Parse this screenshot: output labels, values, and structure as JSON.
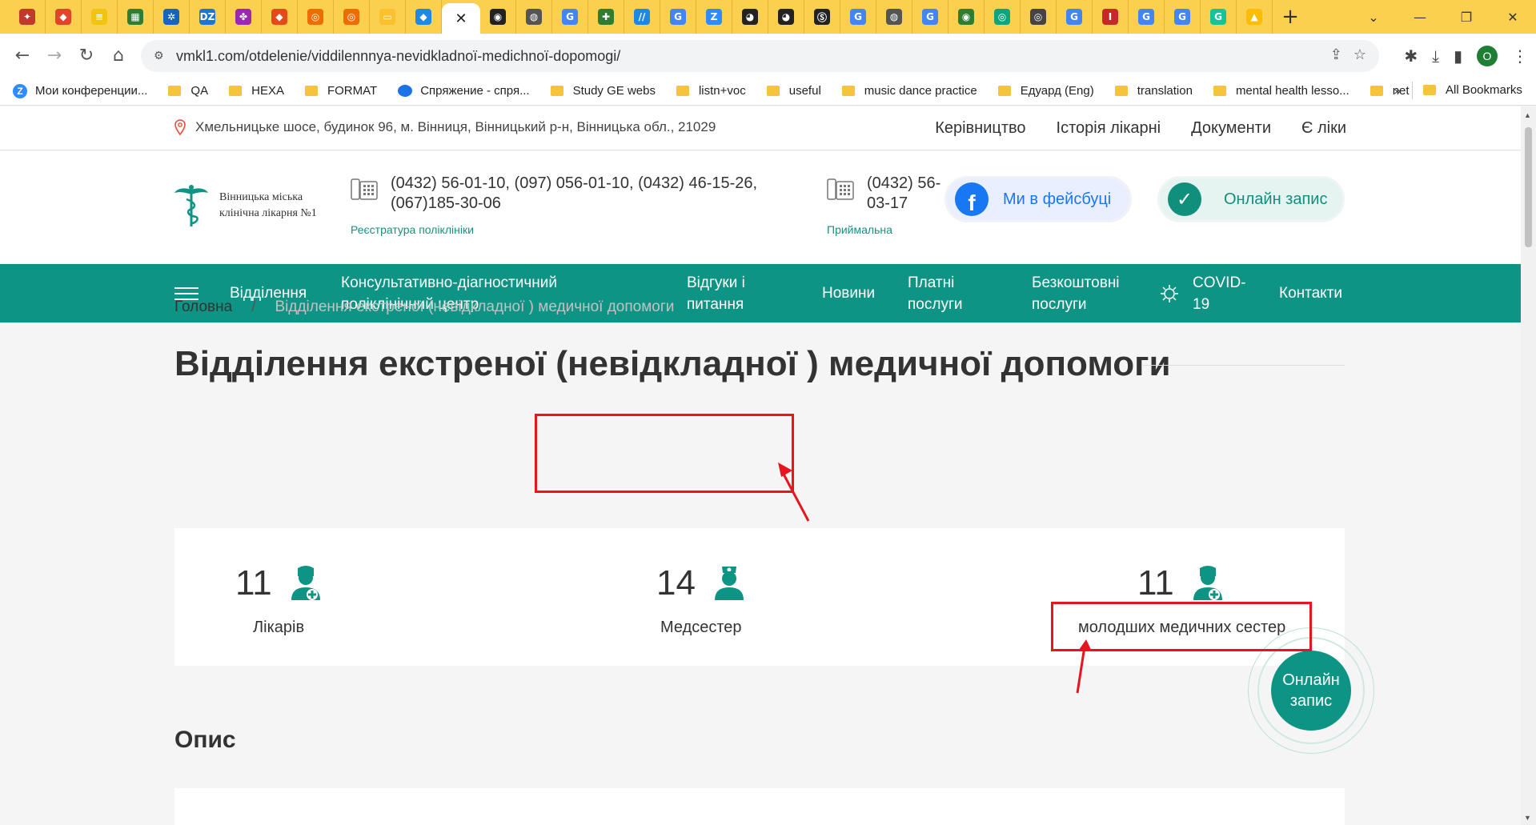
{
  "browser": {
    "tabs": [
      {
        "icon": "bookmark-apple-icon",
        "color": "#c0392b",
        "glyph": "✦"
      },
      {
        "icon": "gitlab-icon",
        "color": "#e24329",
        "glyph": "◆"
      },
      {
        "icon": "notes-icon",
        "color": "#f1c40f",
        "glyph": "≡"
      },
      {
        "icon": "sheet-icon",
        "color": "#2e7d32",
        "glyph": "▦"
      },
      {
        "icon": "puzzle-icon",
        "color": "#1565c0",
        "glyph": "✲"
      },
      {
        "icon": "dzone-icon",
        "color": "#1976d2",
        "glyph": "DZ"
      },
      {
        "icon": "pinwheel-icon",
        "color": "#9c27b0",
        "glyph": "✤"
      },
      {
        "icon": "git-icon",
        "color": "#e64a19",
        "glyph": "◆"
      },
      {
        "icon": "target-icon",
        "color": "#ef6c00",
        "glyph": "◎"
      },
      {
        "icon": "target-icon",
        "color": "#ef6c00",
        "glyph": "◎"
      },
      {
        "icon": "slides-icon",
        "color": "#fbc02d",
        "glyph": "▭"
      },
      {
        "icon": "jira-icon",
        "color": "#1e88e5",
        "glyph": "◆"
      },
      {
        "icon": "close-icon",
        "color": "#ffffff",
        "glyph": "✕",
        "active": true
      },
      {
        "icon": "openai-icon",
        "color": "#222222",
        "glyph": "◉"
      },
      {
        "icon": "globe-icon",
        "color": "#555555",
        "glyph": "◍"
      },
      {
        "icon": "google-icon",
        "color": "#4285f4",
        "glyph": "G"
      },
      {
        "icon": "clover-icon",
        "color": "#2e7d32",
        "glyph": "✚"
      },
      {
        "icon": "stack-icon",
        "color": "#1e88e5",
        "glyph": "//"
      },
      {
        "icon": "google-icon",
        "color": "#4285f4",
        "glyph": "G"
      },
      {
        "icon": "zoom-icon",
        "color": "#2d8cff",
        "glyph": "Z"
      },
      {
        "icon": "github-icon",
        "color": "#222222",
        "glyph": "◕"
      },
      {
        "icon": "github-icon",
        "color": "#222222",
        "glyph": "◕"
      },
      {
        "icon": "se-icon",
        "color": "#222222",
        "glyph": "Ⓢ"
      },
      {
        "icon": "google-icon",
        "color": "#4285f4",
        "glyph": "G"
      },
      {
        "icon": "globe-icon",
        "color": "#555555",
        "glyph": "◍"
      },
      {
        "icon": "google-icon",
        "color": "#4285f4",
        "glyph": "G"
      },
      {
        "icon": "circle-icon",
        "color": "#2e7d32",
        "glyph": "◉"
      },
      {
        "icon": "openai-icon",
        "color": "#10a37f",
        "glyph": "◎"
      },
      {
        "icon": "chrome-icon",
        "color": "#444444",
        "glyph": "◎"
      },
      {
        "icon": "google-icon",
        "color": "#4285f4",
        "glyph": "G"
      },
      {
        "icon": "flag-icon",
        "color": "#c62828",
        "glyph": "I"
      },
      {
        "icon": "google-icon",
        "color": "#4285f4",
        "glyph": "G"
      },
      {
        "icon": "google-icon",
        "color": "#4285f4",
        "glyph": "G"
      },
      {
        "icon": "grammarly-icon",
        "color": "#15c39a",
        "glyph": "G"
      },
      {
        "icon": "drive-icon",
        "color": "#fbbc04",
        "glyph": "▲"
      }
    ],
    "url": "vmkl1.com/otdelenie/viddilennnya-nevidkladnoї-medichnoї-dopomogi/",
    "profile_initial": "O",
    "bookmarks": [
      {
        "type": "zoom",
        "label": "Мои конференции..."
      },
      {
        "type": "folder",
        "label": "QA"
      },
      {
        "type": "folder",
        "label": "HEXA"
      },
      {
        "type": "folder",
        "label": "FORMAT"
      },
      {
        "type": "bubble",
        "label": "Спряжение - спря..."
      },
      {
        "type": "folder",
        "label": "Study GE webs"
      },
      {
        "type": "folder",
        "label": "listn+voc"
      },
      {
        "type": "folder",
        "label": "useful"
      },
      {
        "type": "folder",
        "label": "music dance practice"
      },
      {
        "type": "folder",
        "label": "Едуард (Eng)"
      },
      {
        "type": "folder",
        "label": "translation"
      },
      {
        "type": "folder",
        "label": "mental health lesso..."
      },
      {
        "type": "folder",
        "label": "net"
      }
    ],
    "bookmarks_overflow": "»",
    "all_bookmarks": "All Bookmarks"
  },
  "site": {
    "address": "Хмельницьке шосе, будинок 96, м. Вінниця, Вінницький р-н, Вінницька обл., 21029",
    "top_links": [
      "Керівництво",
      "Історія лікарні",
      "Документи",
      "Є ліки"
    ],
    "logo_line1": "Вінницька міська",
    "logo_line2": "клінічна лікарня №1",
    "phone1_line1": "(0432) 56-01-10, (097) 056-01-10, (0432) 46-15-26,",
    "phone1_line2": "(067)185-30-06",
    "phone1_label": "Реєстратура поліклініки",
    "phone2_line1": "(0432) 56-",
    "phone2_line2": "03-17",
    "phone2_label": "Приймальна",
    "fb_button": "Ми в фейсбуці",
    "online_button": "Онлайн запис",
    "nav": {
      "departments": "Відділення",
      "consult_1": "Консультативно-діагностичний",
      "consult_2": "поліклінічний центр",
      "reviews_1": "Відгуки і",
      "reviews_2": "питання",
      "news": "Новини",
      "paid_1": "Платні",
      "paid_2": "послуги",
      "free_1": "Безкоштовні",
      "free_2": "послуги",
      "covid_1": "COVID-",
      "covid_2": "19",
      "contacts": "Контакти"
    },
    "breadcrumb": {
      "home": "Головна",
      "sep": "/",
      "current": "Відділення екстреної (невідкладної ) медичної допомоги"
    },
    "title": "Відділення екстреної (невідкладної ) медичної допомоги",
    "stats": [
      {
        "value": "11",
        "label": "Лікарів"
      },
      {
        "value": "14",
        "label": "Медсестер"
      },
      {
        "value": "11",
        "label": "молодших медичних сестер"
      }
    ],
    "fab_line1": "Онлайн",
    "fab_line2": "запис",
    "section_title": "Опис"
  },
  "colors": {
    "tabstrip": "#fbd04f",
    "brand_teal": "#0e9484",
    "annotation_red": "#e8141e"
  }
}
